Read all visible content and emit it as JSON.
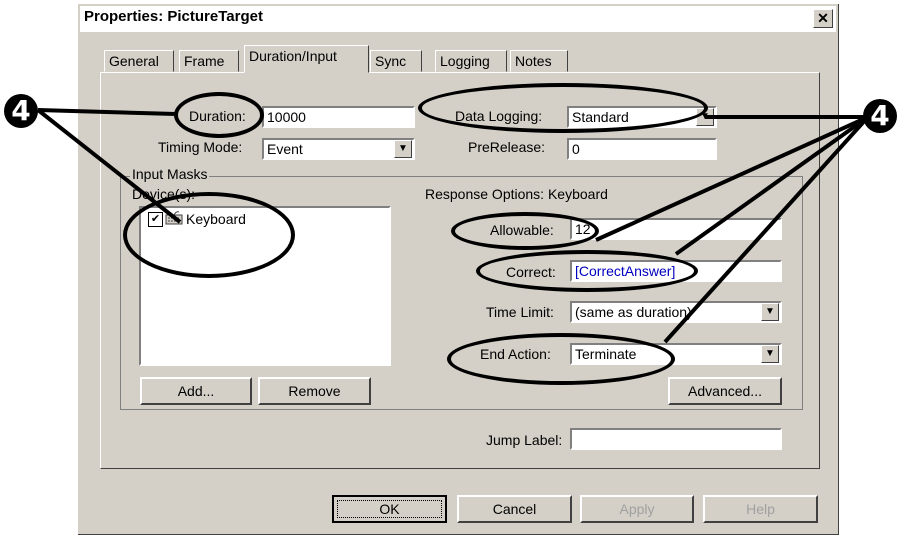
{
  "window": {
    "title": "Properties: PictureTarget",
    "close_glyph": "✕"
  },
  "tabs": [
    {
      "label": "General"
    },
    {
      "label": "Frame"
    },
    {
      "label": "Duration/Input"
    },
    {
      "label": "Sync"
    },
    {
      "label": "Logging"
    },
    {
      "label": "Notes"
    }
  ],
  "fields": {
    "duration": {
      "label": "Duration:",
      "value": "10000"
    },
    "timing_mode": {
      "label": "Timing Mode:",
      "value": "Event"
    },
    "data_logging": {
      "label": "Data Logging:",
      "value": "Standard"
    },
    "prerelease": {
      "label": "PreRelease:",
      "value": "0"
    }
  },
  "input_masks": {
    "legend": "Input Masks",
    "devices_label": "Device(s):",
    "devices": [
      {
        "label": "Keyboard",
        "checked": true,
        "checkmark": "✔"
      }
    ],
    "add_label": "Add...",
    "remove_label": "Remove"
  },
  "response": {
    "header": "Response Options: Keyboard",
    "allowable": {
      "label": "Allowable:",
      "value": "12"
    },
    "correct": {
      "label": "Correct:",
      "value": "[CorrectAnswer]"
    },
    "time_limit": {
      "label": "Time Limit:",
      "value": "(same as duration)"
    },
    "end_action": {
      "label": "End Action:",
      "value": "Terminate"
    },
    "advanced_label": "Advanced...",
    "jump_label": {
      "label": "Jump Label:",
      "value": ""
    }
  },
  "buttons": {
    "ok": "OK",
    "cancel": "Cancel",
    "apply": "Apply",
    "help": "Help"
  },
  "annotation": {
    "badge_text": "4",
    "color": "#000000"
  },
  "colors": {
    "dialog_bg": "#d4d0c8",
    "link_text": "#0000c0"
  }
}
